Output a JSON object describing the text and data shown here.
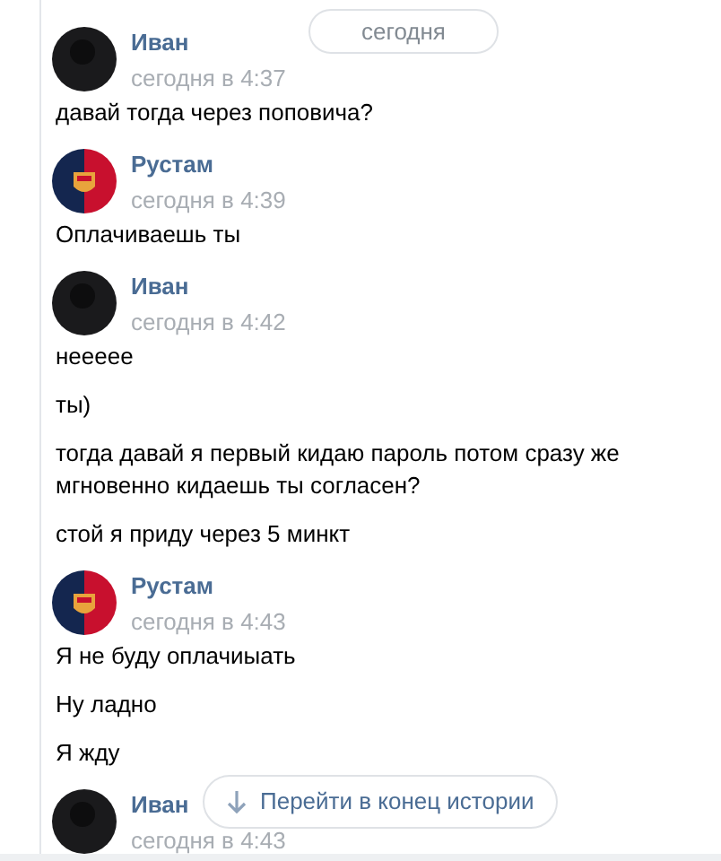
{
  "date_pill": "сегодня",
  "groups": [
    {
      "author": "Иван",
      "time": "сегодня в 4:37",
      "kind": "dark",
      "messages": [
        "давай тогда через поповича?"
      ]
    },
    {
      "author": "Рустам",
      "time": "сегодня в 4:39",
      "kind": "club",
      "messages": [
        "Оплачиваешь ты"
      ]
    },
    {
      "author": "Иван",
      "time": "сегодня в 4:42",
      "kind": "dark",
      "messages": [
        "неееее",
        "ты)",
        "тогда давай я первый кидаю пароль потом сразу же мгновенно кидаешь ты согласен?",
        "стой я приду через 5 минкт"
      ]
    },
    {
      "author": "Рустам",
      "time": "сегодня в 4:43",
      "kind": "club",
      "messages": [
        "Я не буду оплачиыать",
        "Ну ладно",
        "Я жду"
      ]
    },
    {
      "author": "Иван",
      "time": "сегодня в 4:43",
      "kind": "dark"
    }
  ],
  "jump_button": "Перейти в конец истории"
}
